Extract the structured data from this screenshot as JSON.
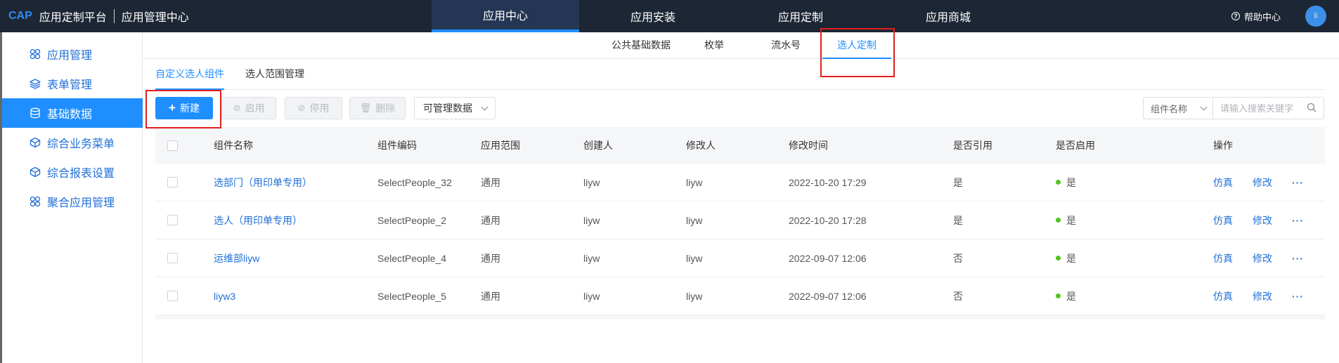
{
  "header": {
    "brand": "CAP",
    "app_name": "应用定制平台",
    "center_name": "应用管理中心",
    "nav": [
      {
        "label": "应用中心",
        "active": true
      },
      {
        "label": "应用安装",
        "active": false
      },
      {
        "label": "应用定制",
        "active": false
      },
      {
        "label": "应用商城",
        "active": false
      }
    ],
    "help_label": "帮助中心",
    "avatar_text": "li"
  },
  "sidebar": {
    "items": [
      {
        "label": "应用管理",
        "icon": "apps-icon",
        "active": false
      },
      {
        "label": "表单管理",
        "icon": "layers-icon",
        "active": false
      },
      {
        "label": "基础数据",
        "icon": "database-icon",
        "active": true
      },
      {
        "label": "综合业务菜单",
        "icon": "cube-icon",
        "active": false
      },
      {
        "label": "综合报表设置",
        "icon": "cube-icon",
        "active": false
      },
      {
        "label": "聚合应用管理",
        "icon": "apps-icon",
        "active": false
      }
    ]
  },
  "subnav": {
    "items": [
      {
        "label": "公共基础数据",
        "active": false
      },
      {
        "label": "枚举",
        "active": false
      },
      {
        "label": "流水号",
        "active": false
      },
      {
        "label": "选人定制",
        "active": true
      }
    ]
  },
  "tabs": [
    {
      "label": "自定义选人组件",
      "active": true
    },
    {
      "label": "选人范围管理",
      "active": false
    }
  ],
  "toolbar": {
    "new_label": "新建",
    "enable_label": "启用",
    "disable_label": "停用",
    "delete_label": "删除",
    "manage_select": "可管理数据",
    "search_field": "组件名称",
    "search_placeholder": "请输入搜索关键字"
  },
  "table": {
    "headers": [
      "组件名称",
      "组件编码",
      "应用范围",
      "创建人",
      "修改人",
      "修改时间",
      "是否引用",
      "是否启用",
      "操作"
    ],
    "rows": [
      {
        "name": "选部门（用印单专用）",
        "code": "SelectPeople_32",
        "scope": "通用",
        "creator": "liyw",
        "modifier": "liyw",
        "time": "2022-10-20 17:29",
        "referenced": "是",
        "enabled": "是"
      },
      {
        "name": "选人（用印单专用）",
        "code": "SelectPeople_2",
        "scope": "通用",
        "creator": "liyw",
        "modifier": "liyw",
        "time": "2022-10-20 17:28",
        "referenced": "是",
        "enabled": "是"
      },
      {
        "name": "运维部liyw",
        "code": "SelectPeople_4",
        "scope": "通用",
        "creator": "liyw",
        "modifier": "liyw",
        "time": "2022-09-07 12:06",
        "referenced": "否",
        "enabled": "是"
      },
      {
        "name": "liyw3",
        "code": "SelectPeople_5",
        "scope": "通用",
        "creator": "liyw",
        "modifier": "liyw",
        "time": "2022-09-07 12:06",
        "referenced": "否",
        "enabled": "是"
      }
    ],
    "actions": {
      "simulate": "仿真",
      "edit": "修改",
      "more": "···"
    }
  },
  "colors": {
    "primary": "#1f8fff",
    "topbar": "#1d2634",
    "highlight_box": "#e0201c",
    "enabled_dot": "#52c41a"
  }
}
